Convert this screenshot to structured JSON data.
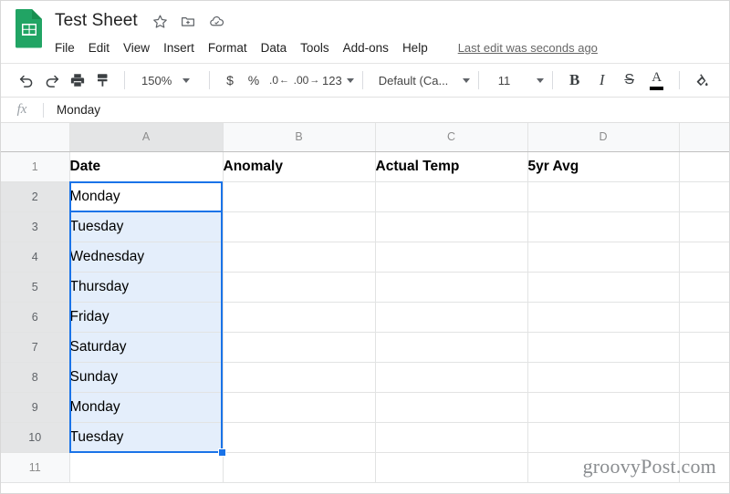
{
  "app": {
    "name": "Google Sheets",
    "logo_color": "#21a464"
  },
  "header": {
    "doc_title": "Test Sheet",
    "icons": [
      {
        "name": "star-icon",
        "label": "Star"
      },
      {
        "name": "move-to-folder-icon",
        "label": "Move to folder"
      },
      {
        "name": "cloud-saved-icon",
        "label": "Saved to Drive"
      }
    ],
    "menu": [
      "File",
      "Edit",
      "View",
      "Insert",
      "Format",
      "Data",
      "Tools",
      "Add-ons",
      "Help"
    ],
    "last_edit": "Last edit was seconds ago"
  },
  "toolbar": {
    "undo_icon": "undo-icon",
    "redo_icon": "redo-icon",
    "print_icon": "print-icon",
    "paint_format_icon": "paint-format-icon",
    "zoom_value": "150%",
    "currency_label": "$",
    "percent_label": "%",
    "decrease_decimal": {
      "num": ".0",
      "arrow": "←"
    },
    "increase_decimal": {
      "num": ".00",
      "arrow": "→"
    },
    "number_format_label": "123",
    "font_family_label": "Default (Ca...",
    "font_size_label": "11",
    "bold_label": "B",
    "italic_label": "I",
    "strikethrough_label": "S",
    "text_color_label": "A",
    "text_color_value": "#000000",
    "fill_color_icon": "fill-color-icon"
  },
  "formula_bar": {
    "fx_label": "fx",
    "value": "Monday"
  },
  "grid": {
    "columns": [
      "A",
      "B",
      "C",
      "D",
      ""
    ],
    "selected_column": "A",
    "rows": [
      "1",
      "2",
      "3",
      "4",
      "5",
      "6",
      "7",
      "8",
      "9",
      "10",
      "11"
    ],
    "selected_rows": [
      "2",
      "3",
      "4",
      "5",
      "6",
      "7",
      "8",
      "9",
      "10"
    ],
    "active_cell": "A2",
    "selection_range": "A2:A10",
    "selection_fill_color": "#e4eefb",
    "selection_border_color": "#1a73e8",
    "cells": [
      {
        "row": "1",
        "A": "Date",
        "B": "Anomaly",
        "C": "Actual Temp",
        "D": "5yr Avg",
        "bold": true
      },
      {
        "row": "2",
        "A": "Monday",
        "B": "",
        "C": "",
        "D": ""
      },
      {
        "row": "3",
        "A": "Tuesday",
        "B": "",
        "C": "",
        "D": ""
      },
      {
        "row": "4",
        "A": "Wednesday",
        "B": "",
        "C": "",
        "D": ""
      },
      {
        "row": "5",
        "A": "Thursday",
        "B": "",
        "C": "",
        "D": ""
      },
      {
        "row": "6",
        "A": "Friday",
        "B": "",
        "C": "",
        "D": ""
      },
      {
        "row": "7",
        "A": "Saturday",
        "B": "",
        "C": "",
        "D": ""
      },
      {
        "row": "8",
        "A": "Sunday",
        "B": "",
        "C": "",
        "D": ""
      },
      {
        "row": "9",
        "A": "Monday",
        "B": "",
        "C": "",
        "D": ""
      },
      {
        "row": "10",
        "A": "Tuesday",
        "B": "",
        "C": "",
        "D": ""
      },
      {
        "row": "11",
        "A": "",
        "B": "",
        "C": "",
        "D": ""
      }
    ]
  },
  "watermark": "groovyPost.com"
}
